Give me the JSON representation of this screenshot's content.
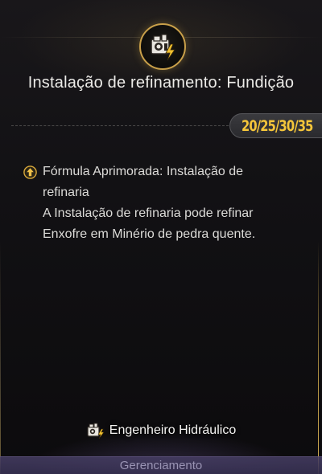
{
  "header": {
    "icon": "refinery-building-icon",
    "title": "Instalação de refinamento: Fundição"
  },
  "level_badge": {
    "text": "20/25/30/35",
    "color": "#f4c53a"
  },
  "description": {
    "icon": "upgrade-arrow-icon",
    "lines": [
      "Fórmula Aprimorada: Instalação de",
      "refinaria",
      "A Instalação de refinaria pode refinar",
      "Enxofre em Minério de pedra quente."
    ]
  },
  "role": {
    "icon": "refinery-building-icon",
    "label": "Engenheiro Hidráulico"
  },
  "footer": {
    "label": "Gerenciamento"
  },
  "colors": {
    "accent_gold": "#c9a04a",
    "badge_text": "#f4c53a",
    "footer_bar": "#3a3458"
  }
}
